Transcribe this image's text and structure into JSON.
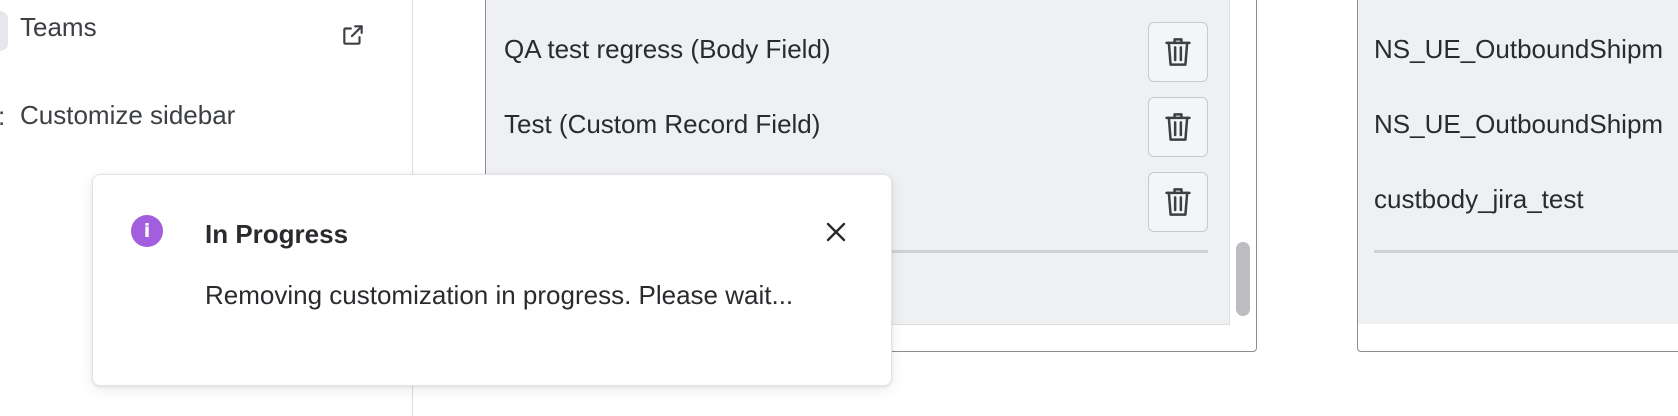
{
  "sidebar": {
    "teams_label": "Teams",
    "customize_label": "Customize sidebar",
    "customize_glyph": ":"
  },
  "middle_panel": {
    "fields": [
      {
        "label": "QA test regress (Body Field)"
      },
      {
        "label": "Test (Custom Record Field)"
      },
      {
        "label": ""
      }
    ]
  },
  "right_panel": {
    "items": [
      "NS_UE_OutboundShipm",
      "NS_UE_OutboundShipm",
      "custbody_jira_test"
    ]
  },
  "toast": {
    "title": "In Progress",
    "message": "Removing customization in progress. Please wait...",
    "icon": "info-icon",
    "icon_color": "#a35ddf"
  },
  "icons": {
    "external_link": "external-link-icon",
    "trash": "trash-icon",
    "close": "close-icon"
  }
}
